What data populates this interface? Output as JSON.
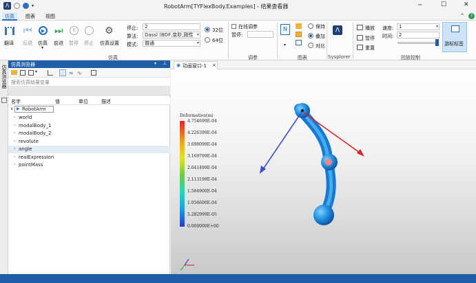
{
  "window": {
    "title": "RobotArm[TYFlexBody.Examples] - 结果查看器"
  },
  "menu": [
    "仿真",
    "图表",
    "视图"
  ],
  "ribbon": {
    "buttons": {
      "translate": "翻译",
      "back": "后退",
      "simulate": "仿真",
      "forward": "前进",
      "pause": "暂停",
      "stop": "停止",
      "settings": "仿真设置"
    },
    "stop_label": "停止:",
    "stop_value": "2",
    "algo_label": "算法:",
    "algo_value": "Dassl (BDF,变阶,刚性",
    "mode_label": "模式:",
    "mode_value": "普通",
    "bit32": "32位",
    "bit64": "64位",
    "online_debug": "在线调参",
    "pause_label": "暂停:",
    "keep": "保持",
    "overlay": "叠加",
    "compare": "对比",
    "play": "播放",
    "pause2": "暂停",
    "reset": "重置",
    "speed_label": "速度:",
    "speed_value": "1",
    "time_label": "时间:",
    "time_value": "2",
    "sys": "Sysplorer",
    "cursor": "游标标签",
    "groups": {
      "sim": "仿真",
      "debug": "调参",
      "chart": "图表",
      "playback": "回放控制"
    }
  },
  "sidestrip": "仿真浏览器",
  "browser": {
    "title": "仿真浏览器",
    "search_placeholder": "搜索仿真结果变量",
    "columns": [
      "名字",
      "值",
      "单位",
      "描述"
    ],
    "root": "RobotArm",
    "items": [
      "world",
      "modalBody_1",
      "modalBody_2",
      "revolute",
      "angle",
      "realExpression",
      "pointMass"
    ],
    "selected_index": 4
  },
  "doctab": "动画窗口-1",
  "legend": {
    "title": "Deformation(m)",
    "ticks": [
      "4.754699E-04",
      "4.226399E-04",
      "3.698099E-04",
      "3.169799E-04",
      "2.641499E-04",
      "2.113199E-04",
      "1.584900E-04",
      "1.056600E-04",
      "5.282999E-05",
      "0.000000E+00"
    ]
  },
  "colors": {
    "accent": "#1e5fa8",
    "arm": "#1f8de0",
    "x_arrow": "#e0202a",
    "y_arrow": "#3b4fc8"
  }
}
